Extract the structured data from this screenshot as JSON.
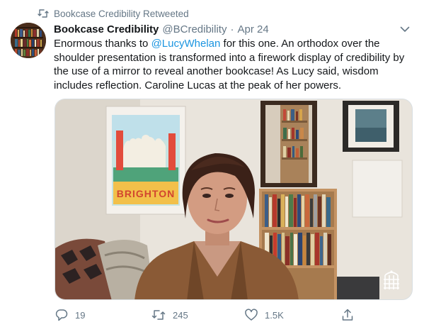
{
  "retweet_banner": {
    "text": "Bookcase Credibility Retweeted"
  },
  "tweet": {
    "author_name": "Bookcase Credibility",
    "author_handle": "@BCredibility",
    "separator": "·",
    "date": "Apr 24",
    "text_before_mention": "Enormous thanks to ",
    "mention": "@LucyWhelan",
    "text_after_mention": " for this one. An orthodox over the shoulder presentation is transformed into a firework display of credibility by the use of a mirror to reveal another bookcase! As Lucy said, wisdom includes reflection. Caroline Lucas at the peak of her powers.",
    "media": {
      "poster_text": "BRIGHTON"
    }
  },
  "actions": {
    "reply_count": "19",
    "retweet_count": "245",
    "like_count": "1.5K"
  },
  "colors": {
    "link": "#1b95e0",
    "secondary_text": "#657786",
    "primary_text": "#14171a"
  },
  "icons": {
    "retweet_banner": "retweet-icon",
    "caret": "chevron-down-icon",
    "reply": "reply-icon",
    "retweet": "retweet-icon",
    "like": "heart-icon",
    "share": "share-icon"
  }
}
